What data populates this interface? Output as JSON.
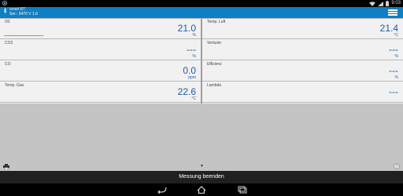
{
  "status": {
    "time": "9:03"
  },
  "header": {
    "title": "smart BT",
    "subtitle": "Ser.: 3470 V 1.6",
    "accent": "#0e7fc3"
  },
  "cells": [
    {
      "label": "O2",
      "value": "21.0",
      "unit": "%"
    },
    {
      "label": "Temp. Luft",
      "value": "21.4",
      "unit": "°C"
    },
    {
      "label": "CO2",
      "value": "---",
      "unit": "%"
    },
    {
      "label": "Verluste",
      "value": "---",
      "unit": "%"
    },
    {
      "label": "CO",
      "value": "0.0",
      "unit": "ppm"
    },
    {
      "label": "Effizienz",
      "value": "---",
      "unit": "%"
    },
    {
      "label": "Temp. Gas",
      "value": "22.6",
      "unit": "°C"
    },
    {
      "label": "Lambda",
      "value": "---",
      "unit": ""
    }
  ],
  "footer": {
    "measure_button": "Messung beenden",
    "help_label": "?"
  },
  "icons": [
    "bluetooth-icon",
    "menu-icon",
    "print-icon",
    "chevron-down-icon",
    "help-icon",
    "back-icon",
    "home-icon",
    "recent-apps-icon",
    "wifi-icon",
    "signal-icon",
    "battery-icon"
  ]
}
